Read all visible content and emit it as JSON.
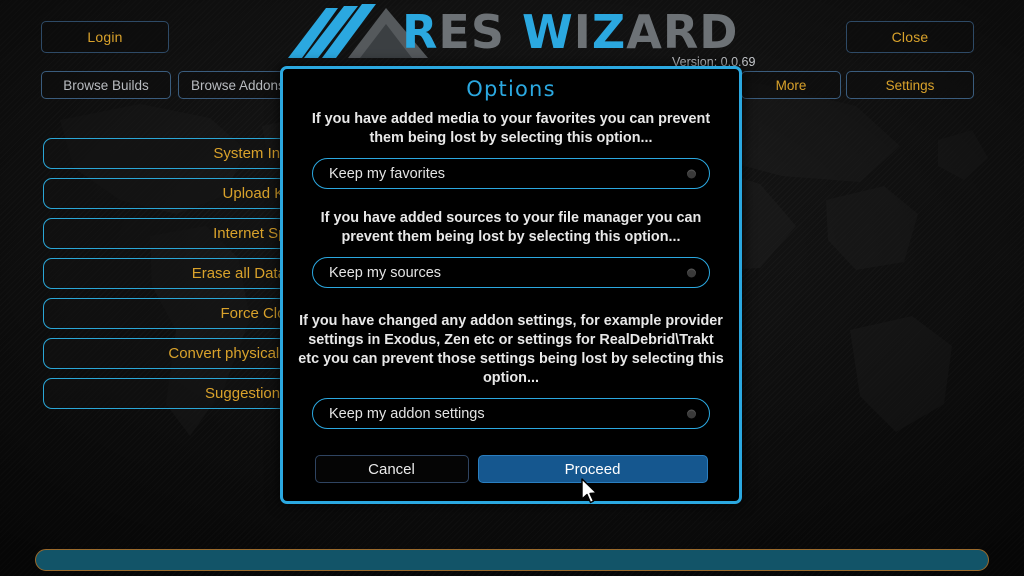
{
  "app": {
    "title": "Ares Wizard",
    "logo_parts": [
      {
        "text": "R",
        "color": "#2ba8e0"
      },
      {
        "text": "ES",
        "color": "#6d7276"
      },
      {
        "text": " W",
        "color": "#2ba8e0"
      },
      {
        "text": "I",
        "color": "#6d7276"
      },
      {
        "text": "Z",
        "color": "#2ba8e0"
      },
      {
        "text": "ARD",
        "color": "#6d7276"
      }
    ],
    "version_label": "Version: 0.0.69",
    "accent_blue": "#2ba8e0",
    "accent_gold": "#d9a22b",
    "progress_fill": "#125468",
    "progress_border": "#9a6a2c"
  },
  "header": {
    "login_label": "Login",
    "close_label": "Close"
  },
  "nav": {
    "browse_builds": "Browse Builds",
    "browse_addons": "Browse Addons",
    "more": "More",
    "settings": "Settings"
  },
  "sidebar": {
    "items": [
      {
        "label": "System Information"
      },
      {
        "label": "Upload Kodi Log"
      },
      {
        "label": "Internet Speed Test"
      },
      {
        "label": "Erase all Data/Fresh Start"
      },
      {
        "label": "Force Close Kodi"
      },
      {
        "label": "Convert physical paths to special"
      },
      {
        "label": "Suggestions welcome"
      }
    ]
  },
  "dialog": {
    "title": "Options",
    "desc_favorites": "If you have added media to your favorites you can prevent them being lost by selecting this option...",
    "desc_sources": "If you have added sources to your file manager you can prevent them being lost by selecting this option...",
    "desc_addons": "If you have changed any addon settings, for example provider settings in Exodus, Zen etc or settings for RealDebrid\\Trakt etc you can prevent those settings being lost by selecting this option...",
    "field_favorites": "Keep my favorites",
    "field_sources": "Keep my sources",
    "field_addons": "Keep my addon settings",
    "cancel_label": "Cancel",
    "proceed_label": "Proceed"
  }
}
